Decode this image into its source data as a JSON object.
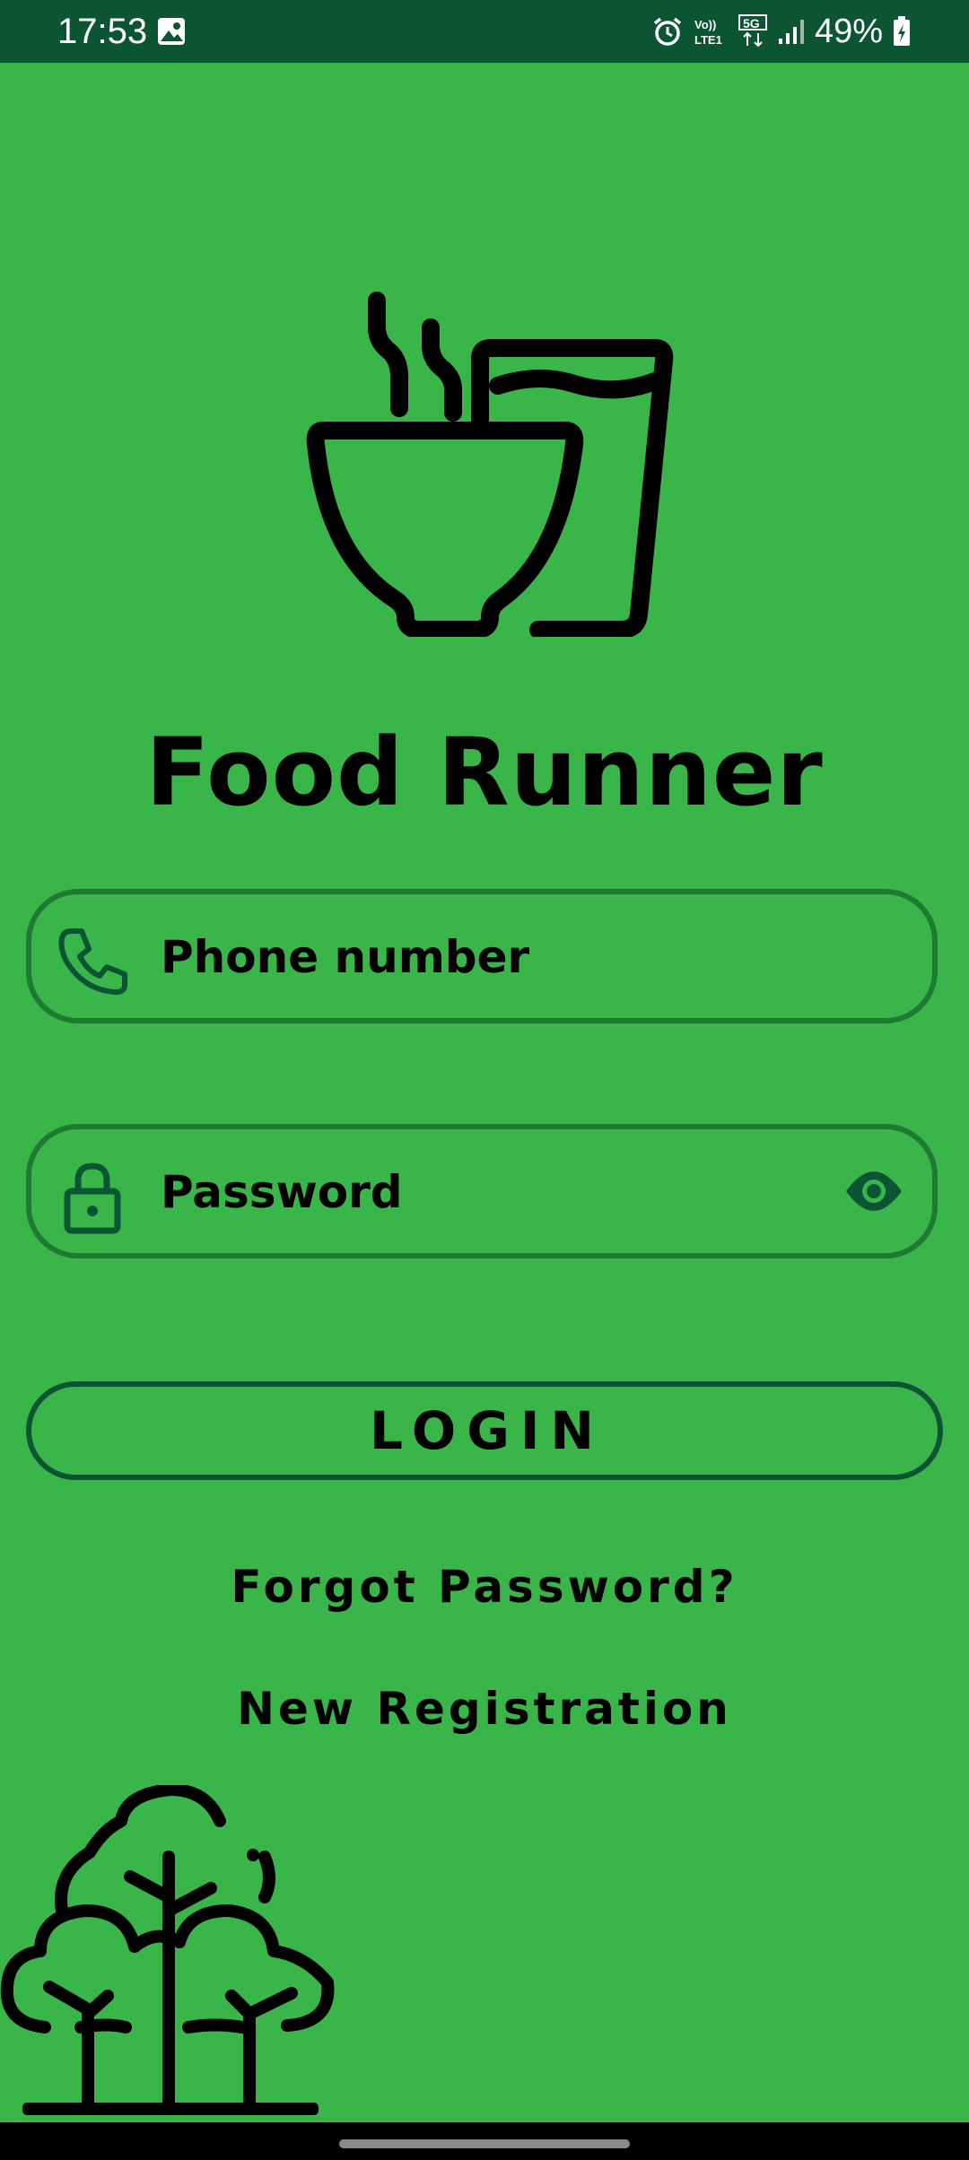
{
  "status_bar": {
    "time": "17:53",
    "battery": "49%",
    "network": "5G",
    "volte": "Vo)) LTE1",
    "icons": [
      "image-icon",
      "alarm-icon",
      "volte-icon",
      "5g-icon",
      "signal-icon",
      "battery-icon"
    ]
  },
  "app": {
    "title": "Food Runner"
  },
  "form": {
    "phone_placeholder": "Phone number",
    "password_placeholder": "Password",
    "login_label": "LOGIN",
    "forgot_label": "Forgot Password?",
    "register_label": "New Registration"
  },
  "colors": {
    "background": "#39b54a",
    "status_bar": "#0b5534",
    "field_border": "#1e7a32",
    "text": "#000000"
  }
}
